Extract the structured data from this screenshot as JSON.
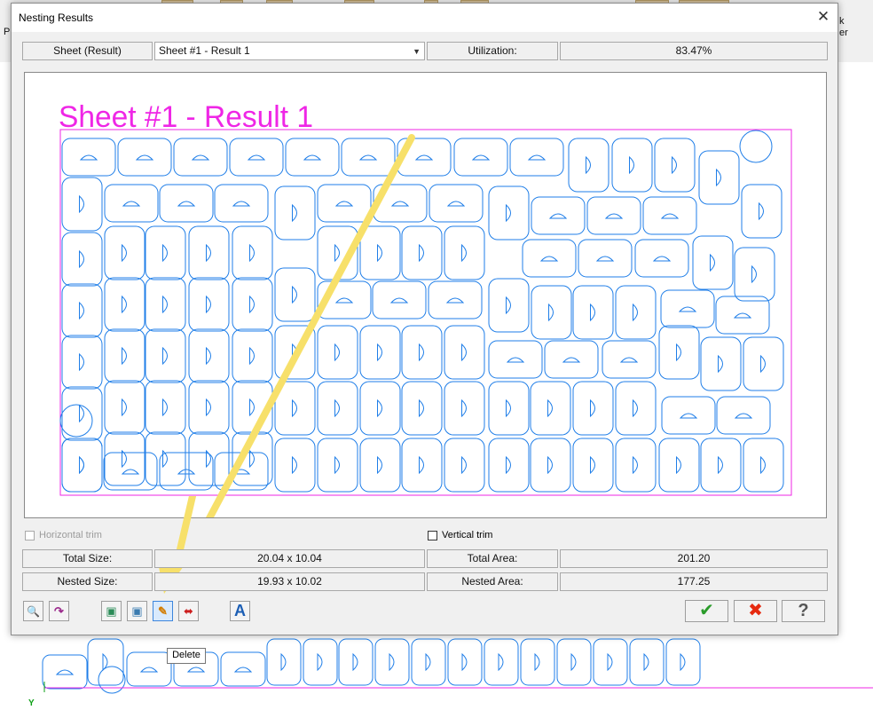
{
  "background": {
    "strip_texts": [
      "Pr",
      "k",
      "er"
    ],
    "y_axis": "Y"
  },
  "dialog": {
    "title": "Nesting Results",
    "close_symbol": "✕",
    "sheet_label": "Sheet (Result)",
    "sheet_value": "Sheet #1 - Result 1",
    "utilization_label": "Utilization:",
    "utilization_value": "83.47%",
    "canvas_title": "Sheet #1 - Result 1",
    "horizontal_trim": "Horizontal trim",
    "vertical_trim": "Vertical trim",
    "total_size_label": "Total Size:",
    "total_size_value": "20.04 x 10.04",
    "total_area_label": "Total Area:",
    "total_area_value": "201.20",
    "nested_size_label": "Nested Size:",
    "nested_size_value": "19.93 x 10.02",
    "nested_area_label": "Nested Area:",
    "nested_area_value": "177.25",
    "tooltip": "Delete",
    "toolbar_symbols": {
      "preview": "🔍",
      "redo": "↷",
      "copy": "▣",
      "duplicate": "▣",
      "edit": "✎",
      "mirror": "⬌",
      "text": "A",
      "ok": "✔",
      "cancel": "✖",
      "help": "?"
    }
  },
  "colors": {
    "accent": "#ef26e6",
    "part": "#1f7ee8",
    "ok": "#2b9c2b",
    "cancel": "#e62a10",
    "highlight": "#f7e06a"
  }
}
